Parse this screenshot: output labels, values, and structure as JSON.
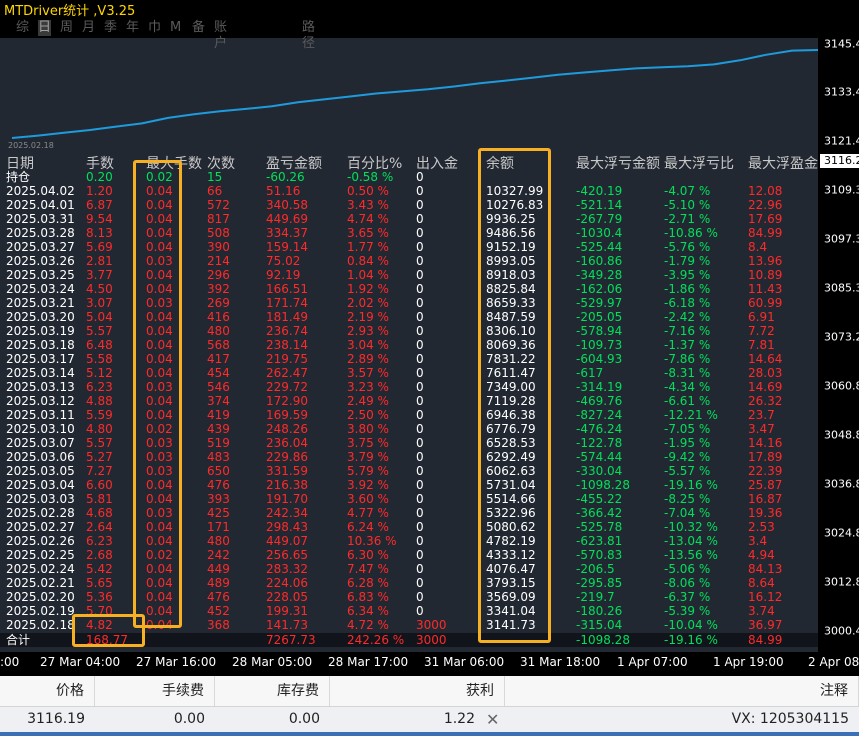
{
  "window": {
    "title": "MTDriver统计 ,V3.25"
  },
  "tabs": [
    {
      "label": "综"
    },
    {
      "label": "日",
      "active": true
    },
    {
      "label": "周"
    },
    {
      "label": "月"
    },
    {
      "label": "季"
    },
    {
      "label": "年"
    },
    {
      "label": "巾"
    },
    {
      "label": "M"
    },
    {
      "label": "备"
    },
    {
      "label": "账户"
    },
    {
      "label": "路径"
    }
  ],
  "equity_start_date": "2025.02.18",
  "price_axis": {
    "ticks": [
      "3145.4",
      "3133.4",
      "3121.4",
      "3109.3",
      "3097.3",
      "3085.3",
      "3073.2",
      "3060.8",
      "3048.8",
      "3036.8",
      "3024.8",
      "3012.8",
      "3000.4"
    ],
    "current_price": "3116.2"
  },
  "time_axis": {
    "ticks": [
      ":00",
      "27 Mar 04:00",
      "27 Mar 16:00",
      "28 Mar 05:00",
      "28 Mar 17:00",
      "31 Mar 06:00",
      "31 Mar 18:00",
      "1 Apr 07:00",
      "1 Apr 19:00",
      "2 Apr 08:"
    ]
  },
  "table": {
    "headers": [
      "日期",
      "手数",
      "最大手数",
      "次数",
      "盈亏金额",
      "百分比%",
      "出入金",
      "余额",
      "最大浮亏金额",
      "最大浮亏比",
      "最大浮盈金"
    ],
    "holding": {
      "label": "持仓",
      "lots": "0.20",
      "max_lots": "0.02",
      "count": "15",
      "pnl": "-60.26",
      "pct": "-0.58 %",
      "deposit": "0"
    },
    "rows": [
      [
        "2025.04.02",
        "1.20",
        "0.04",
        "66",
        "51.16",
        "0.50 %",
        "0",
        "10327.99",
        "-420.19",
        "-4.07 %",
        "12.08"
      ],
      [
        "2025.04.01",
        "6.87",
        "0.04",
        "572",
        "340.58",
        "3.43 %",
        "0",
        "10276.83",
        "-521.14",
        "-5.10 %",
        "22.96"
      ],
      [
        "2025.03.31",
        "9.54",
        "0.04",
        "817",
        "449.69",
        "4.74 %",
        "0",
        "9936.25",
        "-267.79",
        "-2.71 %",
        "17.69"
      ],
      [
        "2025.03.28",
        "8.13",
        "0.04",
        "508",
        "334.37",
        "3.65 %",
        "0",
        "9486.56",
        "-1030.4",
        "-10.86 %",
        "84.99"
      ],
      [
        "2025.03.27",
        "5.69",
        "0.04",
        "390",
        "159.14",
        "1.77 %",
        "0",
        "9152.19",
        "-525.44",
        "-5.76 %",
        "8.4"
      ],
      [
        "2025.03.26",
        "2.81",
        "0.03",
        "214",
        "75.02",
        "0.84 %",
        "0",
        "8993.05",
        "-160.86",
        "-1.79 %",
        "13.96"
      ],
      [
        "2025.03.25",
        "3.77",
        "0.04",
        "296",
        "92.19",
        "1.04 %",
        "0",
        "8918.03",
        "-349.28",
        "-3.95 %",
        "10.89"
      ],
      [
        "2025.03.24",
        "4.50",
        "0.04",
        "392",
        "166.51",
        "1.92 %",
        "0",
        "8825.84",
        "-162.06",
        "-1.86 %",
        "11.43"
      ],
      [
        "2025.03.21",
        "3.07",
        "0.03",
        "269",
        "171.74",
        "2.02 %",
        "0",
        "8659.33",
        "-529.97",
        "-6.18 %",
        "60.99"
      ],
      [
        "2025.03.20",
        "5.04",
        "0.04",
        "416",
        "181.49",
        "2.19 %",
        "0",
        "8487.59",
        "-205.05",
        "-2.42 %",
        "6.91"
      ],
      [
        "2025.03.19",
        "5.57",
        "0.04",
        "480",
        "236.74",
        "2.93 %",
        "0",
        "8306.10",
        "-578.94",
        "-7.16 %",
        "7.72"
      ],
      [
        "2025.03.18",
        "6.48",
        "0.04",
        "568",
        "238.14",
        "3.04 %",
        "0",
        "8069.36",
        "-109.73",
        "-1.37 %",
        "7.81"
      ],
      [
        "2025.03.17",
        "5.58",
        "0.04",
        "417",
        "219.75",
        "2.89 %",
        "0",
        "7831.22",
        "-604.93",
        "-7.86 %",
        "14.64"
      ],
      [
        "2025.03.14",
        "5.12",
        "0.04",
        "454",
        "262.47",
        "3.57 %",
        "0",
        "7611.47",
        "-617",
        "-8.31 %",
        "28.03"
      ],
      [
        "2025.03.13",
        "6.23",
        "0.03",
        "546",
        "229.72",
        "3.23 %",
        "0",
        "7349.00",
        "-314.19",
        "-4.34 %",
        "14.69"
      ],
      [
        "2025.03.12",
        "4.88",
        "0.04",
        "374",
        "172.90",
        "2.49 %",
        "0",
        "7119.28",
        "-469.76",
        "-6.61 %",
        "26.32"
      ],
      [
        "2025.03.11",
        "5.59",
        "0.04",
        "419",
        "169.59",
        "2.50 %",
        "0",
        "6946.38",
        "-827.24",
        "-12.21 %",
        "23.7"
      ],
      [
        "2025.03.10",
        "4.80",
        "0.02",
        "439",
        "248.26",
        "3.80 %",
        "0",
        "6776.79",
        "-476.24",
        "-7.05 %",
        "3.47"
      ],
      [
        "2025.03.07",
        "5.57",
        "0.03",
        "519",
        "236.04",
        "3.75 %",
        "0",
        "6528.53",
        "-122.78",
        "-1.95 %",
        "14.16"
      ],
      [
        "2025.03.06",
        "5.27",
        "0.03",
        "483",
        "229.86",
        "3.79 %",
        "0",
        "6292.49",
        "-574.44",
        "-9.42 %",
        "17.89"
      ],
      [
        "2025.03.05",
        "7.27",
        "0.03",
        "650",
        "331.59",
        "5.79 %",
        "0",
        "6062.63",
        "-330.04",
        "-5.57 %",
        "22.39"
      ],
      [
        "2025.03.04",
        "6.60",
        "0.04",
        "476",
        "216.38",
        "3.92 %",
        "0",
        "5731.04",
        "-1098.28",
        "-19.16 %",
        "25.87"
      ],
      [
        "2025.03.03",
        "5.81",
        "0.04",
        "393",
        "191.70",
        "3.60 %",
        "0",
        "5514.66",
        "-455.22",
        "-8.25 %",
        "16.87"
      ],
      [
        "2025.02.28",
        "4.68",
        "0.03",
        "425",
        "242.34",
        "4.77 %",
        "0",
        "5322.96",
        "-366.42",
        "-7.04 %",
        "19.36"
      ],
      [
        "2025.02.27",
        "2.64",
        "0.04",
        "171",
        "298.43",
        "6.24 %",
        "0",
        "5080.62",
        "-525.78",
        "-10.32 %",
        "2.53"
      ],
      [
        "2025.02.26",
        "6.23",
        "0.04",
        "480",
        "449.07",
        "10.36 %",
        "0",
        "4782.19",
        "-623.81",
        "-13.04 %",
        "3.4"
      ],
      [
        "2025.02.25",
        "2.68",
        "0.02",
        "242",
        "256.65",
        "6.30 %",
        "0",
        "4333.12",
        "-570.83",
        "-13.56 %",
        "4.94"
      ],
      [
        "2025.02.24",
        "5.42",
        "0.04",
        "449",
        "283.32",
        "7.47 %",
        "0",
        "4076.47",
        "-206.5",
        "-5.06 %",
        "84.13"
      ],
      [
        "2025.02.21",
        "5.65",
        "0.04",
        "489",
        "224.06",
        "6.28 %",
        "0",
        "3793.15",
        "-295.85",
        "-8.06 %",
        "8.64"
      ],
      [
        "2025.02.20",
        "5.36",
        "0.04",
        "476",
        "228.05",
        "6.83 %",
        "0",
        "3569.09",
        "-219.7",
        "-6.37 %",
        "16.12"
      ],
      [
        "2025.02.19",
        "5.70",
        "0.04",
        "452",
        "199.31",
        "6.34 %",
        "0",
        "3341.04",
        "-180.26",
        "-5.39 %",
        "3.74"
      ],
      [
        "2025.02.18",
        "4.82",
        "0.04",
        "368",
        "141.73",
        "4.72 %",
        "3000",
        "3141.73",
        "-315.04",
        "-10.04 %",
        "36.97"
      ]
    ],
    "total": {
      "label": "合计",
      "lots": "168.77",
      "pnl": "7267.73",
      "pct": "242.26 %",
      "deposit": "3000",
      "max_dd": "-1098.28",
      "max_dd_pct": "-19.16 %",
      "max_gain": "84.99"
    }
  },
  "equity_curve": [
    3141.73,
    3341.04,
    3569.09,
    3793.15,
    4076.47,
    4333.12,
    4782.19,
    5080.62,
    5322.96,
    5514.66,
    5731.04,
    6062.63,
    6292.49,
    6528.53,
    6776.79,
    6946.38,
    7119.28,
    7349.0,
    7611.47,
    7831.22,
    8069.36,
    8306.1,
    8487.59,
    8659.33,
    8825.84,
    8918.03,
    8993.05,
    9152.19,
    9486.56,
    9936.25,
    10276.83,
    10327.99
  ],
  "colors": {
    "profit": "#ff2a2a",
    "loss": "#00e05a",
    "curve": "#1e9bdc",
    "highlight": "#f6b021"
  },
  "bottom_panel": {
    "headers": [
      "价格",
      "手续费",
      "库存费",
      "获利",
      "注释"
    ],
    "values": [
      "3116.19",
      "0.00",
      "0.00",
      "1.22",
      "VX:  1205304115"
    ]
  }
}
